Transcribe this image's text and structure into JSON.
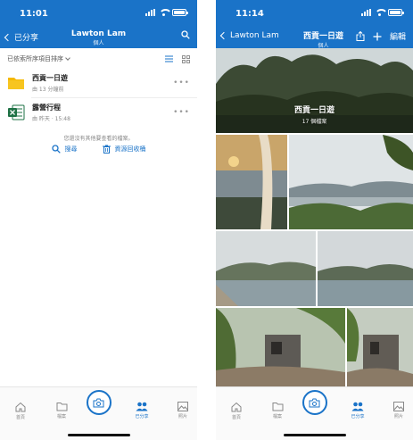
{
  "left": {
    "status": {
      "time": "11:01"
    },
    "nav": {
      "back": "已分享",
      "title": "Lawton Lam",
      "subtitle": "個人"
    },
    "sort": {
      "label": "已依索所序項目排序"
    },
    "files": [
      {
        "name": "西貢一日遊",
        "meta": "由 13 分鐘前"
      },
      {
        "name": "露營行程",
        "meta": "由 昨天 · 15:48"
      }
    ],
    "hint": "您還沒有其他要查看的檔案。",
    "actions": {
      "search": "搜尋",
      "recycle": "資源回收桶"
    },
    "tabs": {
      "home": "首頁",
      "files": "檔案",
      "shared": "已分享",
      "photos": "照片"
    }
  },
  "right": {
    "status": {
      "time": "11:14"
    },
    "nav": {
      "back": "Lawton Lam",
      "title": "西貢一日遊",
      "subtitle": "個人",
      "edit": "編輯"
    },
    "album": {
      "title": "西貢一日遊",
      "count": "17 個檔案"
    },
    "tabs": {
      "home": "首頁",
      "files": "檔案",
      "shared": "已分享",
      "photos": "照片"
    }
  },
  "colors": {
    "accent": "#1a73c8",
    "folder": "#f5b800",
    "excel": "#1e7145"
  },
  "icons": [
    "search-icon",
    "list-view-icon",
    "grid-view-icon",
    "folder-icon",
    "excel-file-icon",
    "more-icon",
    "recycle-bin-icon",
    "home-icon",
    "files-icon",
    "camera-icon",
    "people-icon",
    "photos-icon",
    "share-icon",
    "add-icon"
  ]
}
